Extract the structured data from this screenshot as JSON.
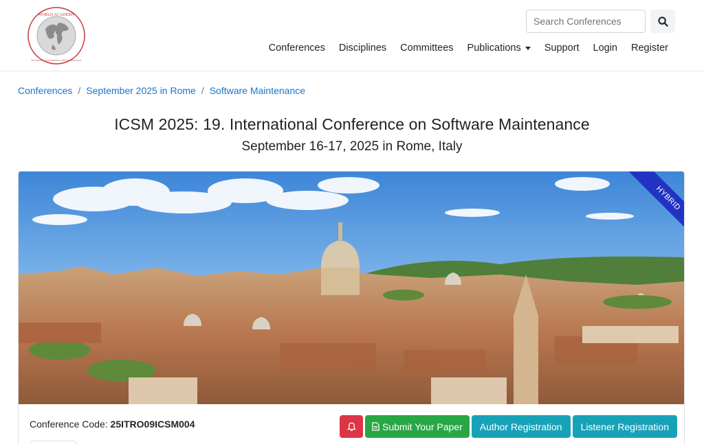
{
  "header": {
    "logo_icon": "globe-seal-icon",
    "logo_text_top": "WORLD ACADEMY",
    "logo_text_bottom": "OF SCIENCE, ENGINEERING AND TECHNOLOGY",
    "search": {
      "placeholder": "Search Conferences",
      "value": "",
      "icon": "search-icon"
    },
    "nav": [
      {
        "label": "Conferences"
      },
      {
        "label": "Disciplines"
      },
      {
        "label": "Committees"
      },
      {
        "label": "Publications",
        "dropdown": true
      },
      {
        "label": "Support"
      },
      {
        "label": "Login"
      },
      {
        "label": "Register"
      }
    ]
  },
  "breadcrumb": [
    {
      "label": "Conferences"
    },
    {
      "label": "September 2025 in Rome"
    },
    {
      "label": "Software Maintenance"
    }
  ],
  "conference": {
    "title": "ICSM 2025: 19. International Conference on Software Maintenance",
    "subtitle": "September 16-17, 2025 in Rome, Italy",
    "ribbon": "HYBRID",
    "code_label": "Conference Code:",
    "code_value": "25ITRO09ICSM004"
  },
  "actions": {
    "bell_icon": "bell-icon",
    "submit_icon": "document-icon",
    "submit_label": "Submit Your Paper",
    "author_label": "Author Registration",
    "listener_label": "Listener Registration"
  },
  "colors": {
    "link": "#1a73c9",
    "danger": "#dc3545",
    "success": "#28a745",
    "info": "#17a2b8",
    "ribbon": "#2233c4"
  }
}
